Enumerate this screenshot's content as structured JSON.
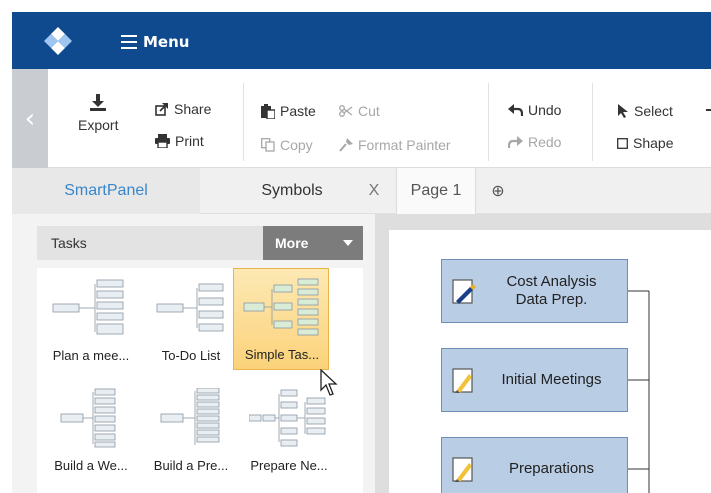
{
  "header": {
    "menu_label": "Menu",
    "color": "#0f4a8e"
  },
  "toolbar": {
    "collapse_glyph": "‹",
    "export_label": "Export",
    "share_label": "Share",
    "print_label": "Print",
    "paste_label": "Paste",
    "cut_label": "Cut",
    "copy_label": "Copy",
    "format_painter_label": "Format Painter",
    "undo_label": "Undo",
    "redo_label": "Redo",
    "select_label": "Select",
    "shape_label": "Shape"
  },
  "tabs": {
    "smartpanel": "SmartPanel",
    "symbols": "Symbols",
    "symbols_close": "X",
    "page": "Page 1",
    "add_page": "⊕"
  },
  "panel": {
    "section_label": "Tasks",
    "more_label": "More",
    "templates": [
      {
        "label": "Plan a mee..."
      },
      {
        "label": "To-Do List"
      },
      {
        "label": "Simple Tas..."
      },
      {
        "label": "Build a We..."
      },
      {
        "label": "Build a Pre..."
      },
      {
        "label": "Prepare Ne..."
      }
    ],
    "selected_index": 2,
    "accent": "#3a86c8"
  },
  "canvas": {
    "shapes": [
      {
        "text": "Cost Analysis Data Prep."
      },
      {
        "text": "Initial Meetings"
      },
      {
        "text": "Preparations"
      }
    ],
    "shape_fill": "#b9cde5",
    "shape_border": "#6f8db5"
  }
}
